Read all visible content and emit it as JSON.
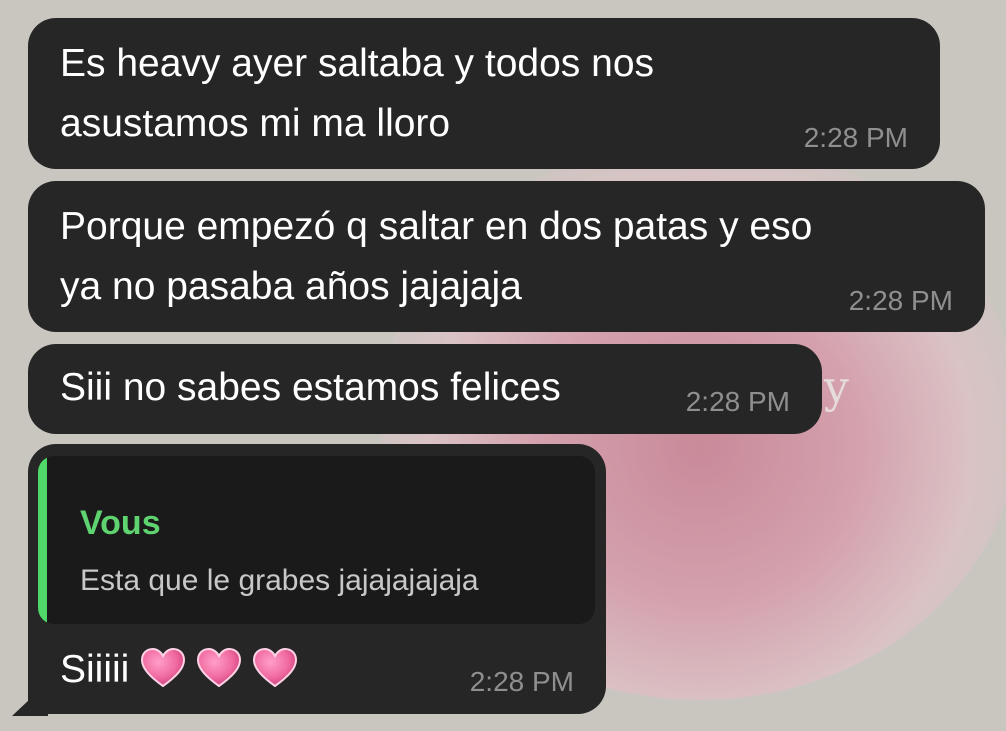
{
  "messages": [
    {
      "id": "b1",
      "lines": [
        "Es heavy ayer saltaba y todos nos",
        "asustamos mi ma lloro"
      ],
      "time": "2:28 PM"
    },
    {
      "id": "b2",
      "lines": [
        "Porque empezó q saltar en dos patas y eso",
        "ya no pasaba años jajajaja"
      ],
      "time": "2:28 PM"
    },
    {
      "id": "b3",
      "lines": [
        "Siii no sabes estamos felices"
      ],
      "time": "2:28 PM"
    },
    {
      "id": "b4",
      "reply": {
        "author": "Vous",
        "text": "Esta que le grabes jajajajajaja"
      },
      "text": "Siiiii",
      "emoji": [
        "heart-icon",
        "heart-icon",
        "heart-icon"
      ],
      "time": "2:28 PM"
    }
  ],
  "colors": {
    "bubble": "#262626",
    "quote_bg": "#1a1a1a",
    "quote_accent": "#50d96a",
    "time": "#8f8f8f",
    "heart": "#f06aa0"
  },
  "wallpaper_glyph": "y"
}
